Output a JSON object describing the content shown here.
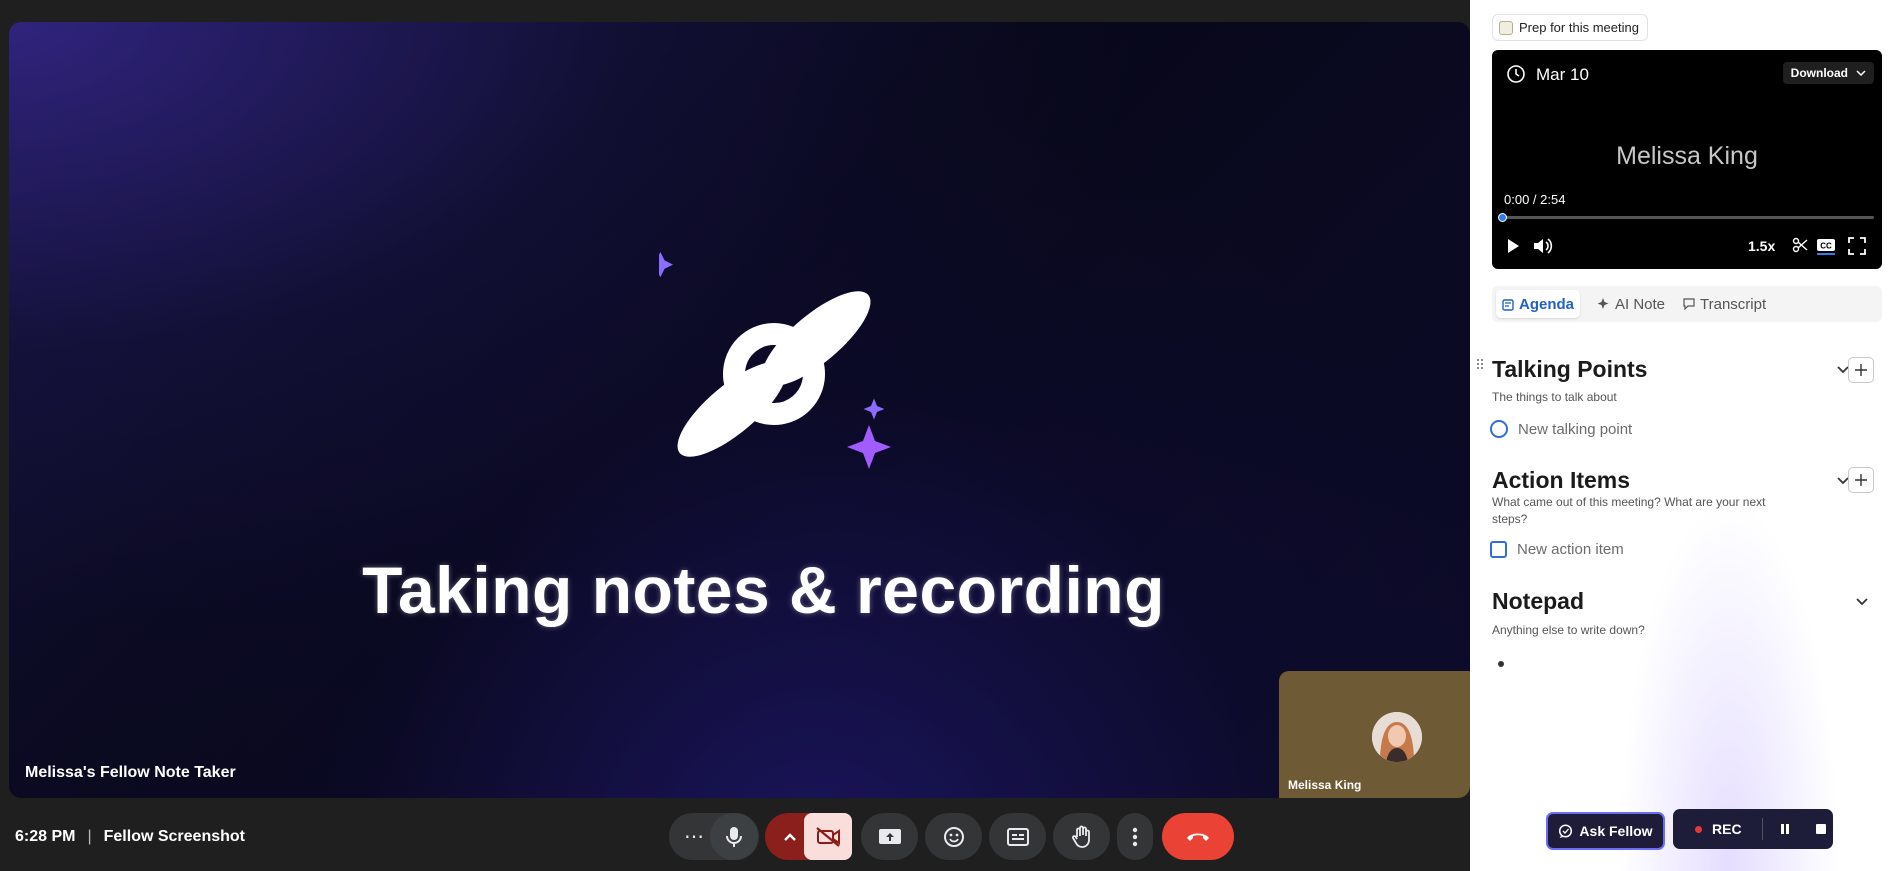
{
  "meet": {
    "headline": "Taking notes & recording",
    "presenter_label": "Melissa's Fellow Note Taker",
    "self_tile_name": "Melissa King",
    "time": "6:28 PM",
    "separator": "|",
    "meeting_title": "Fellow Screenshot",
    "controls": [
      {
        "name": "more-options",
        "icon": "ellipsis-icon"
      },
      {
        "name": "microphone",
        "icon": "mic-icon"
      },
      {
        "name": "camera-options",
        "icon": "chevron-up-icon"
      },
      {
        "name": "camera-toggle",
        "icon": "camera-off-icon",
        "state": "off"
      },
      {
        "name": "present-screen",
        "icon": "present-icon"
      },
      {
        "name": "reactions",
        "icon": "emoji-icon"
      },
      {
        "name": "captions",
        "icon": "captions-icon"
      },
      {
        "name": "raise-hand",
        "icon": "hand-icon"
      },
      {
        "name": "more-actions",
        "icon": "kebab-icon"
      },
      {
        "name": "leave-call",
        "icon": "hang-up-icon"
      }
    ],
    "colors": {
      "leave": "#ea4335",
      "camera_off_bg": "#f9dedc",
      "accent_purple": "#7b5cff"
    }
  },
  "panel": {
    "prep_label": "Prep for this meeting",
    "video": {
      "date": "Mar 10",
      "download_label": "Download",
      "participant": "Melissa King",
      "time_display": "0:00 / 2:54",
      "progress": 0,
      "speed": "1.5x"
    },
    "tabs": [
      {
        "label": "Agenda",
        "active": true
      },
      {
        "label": "AI Note",
        "active": false
      },
      {
        "label": "Transcript",
        "active": false
      }
    ],
    "sections": {
      "talking_points": {
        "title": "Talking Points",
        "subtitle": "The things to talk about",
        "placeholder": "New talking point"
      },
      "action_items": {
        "title": "Action Items",
        "subtitle": "What came out of this meeting? What are your next steps?",
        "placeholder": "New action item"
      },
      "notepad": {
        "title": "Notepad",
        "subtitle": "Anything else to write down?"
      }
    },
    "ask_fellow": "Ask Fellow",
    "rec_label": "REC"
  }
}
